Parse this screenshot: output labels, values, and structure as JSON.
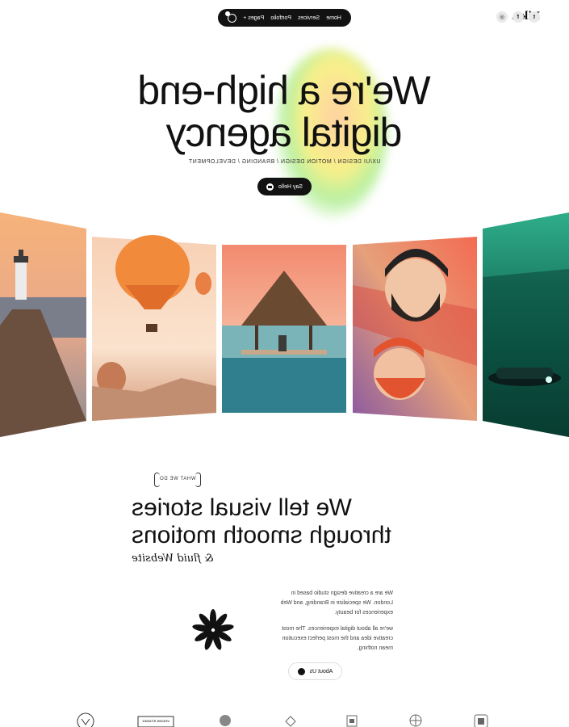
{
  "brand": {
    "logo": "Liko."
  },
  "nav": {
    "items": [
      "Home",
      "Services",
      "Portfolio",
      "Pages +"
    ],
    "cart_count": "0"
  },
  "socials": [
    "instagram-icon",
    "facebook-icon",
    "twitter-icon"
  ],
  "hero": {
    "title_line1": "We're a high-end",
    "title_line2": "digital agency",
    "subtitle": "UX/UI DESIGN / MOTION DESIGN / BRANDING / DEVELOPMENT",
    "cta": "Say Hello"
  },
  "gallery": [
    "lighthouse-pier-image",
    "hot-air-balloons-image",
    "tropical-hut-pool-image",
    "bearded-men-illustration",
    "green-car-night-image"
  ],
  "about": {
    "tag": "WHAT WE DO",
    "title_line1": "We tell visual stories",
    "title_line2": "through smooth motions",
    "subtitle": "& fluid Website",
    "para1": "We are a creative design studio based in London. We specialize in Branding, and Web experiences for beauty.",
    "para2": "we're all about digital experiences. The most creative idea and the most perfect execution mean nothing.",
    "cta": "About Us"
  },
  "partner_logos": [
    "partner-logo-1",
    "partner-logo-2",
    "partner-logo-3",
    "partner-logo-4",
    "partner-logo-5",
    "partner-logo-6",
    "partner-logo-7"
  ],
  "partner_logo_text": "VISION STUDIO",
  "colors": {
    "dark": "#121212",
    "glow_green": "#b9f0a0",
    "glow_yellow": "#f8f08a",
    "glow_peach": "#ffd1a3"
  }
}
